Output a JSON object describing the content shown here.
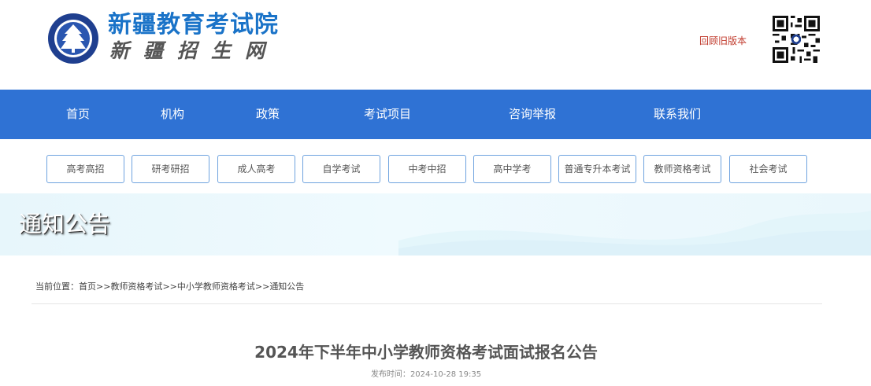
{
  "header": {
    "site_title": "新疆教育考试院",
    "site_subtitle": "新疆招生网",
    "old_version_link": "回顾旧版本",
    "emblem_text": "新疆教育考试院"
  },
  "nav": {
    "items": [
      {
        "label": "首页"
      },
      {
        "label": "机构"
      },
      {
        "label": "政策"
      },
      {
        "label": "考试项目"
      },
      {
        "label": "咨询举报"
      },
      {
        "label": "联系我们"
      }
    ]
  },
  "categories": [
    {
      "label": "高考高招"
    },
    {
      "label": "研考研招"
    },
    {
      "label": "成人高考"
    },
    {
      "label": "自学考试"
    },
    {
      "label": "中考中招"
    },
    {
      "label": "高中学考"
    },
    {
      "label": "普通专升本考试"
    },
    {
      "label": "教师资格考试"
    },
    {
      "label": "社会考试"
    }
  ],
  "banner": {
    "title": "通知公告"
  },
  "breadcrumb": {
    "prefix": "当前位置：",
    "items": [
      {
        "label": "首页"
      },
      {
        "label": "教师资格考试"
      },
      {
        "label": "中小学教师资格考试"
      },
      {
        "label": "通知公告"
      }
    ],
    "separator": ">>"
  },
  "article": {
    "title": "2024年下半年中小学教师资格考试面试报名公告",
    "publish_label": "发布时间：",
    "publish_time": "2024-10-28 19:35"
  },
  "colors": {
    "nav_bg": "#2f72d4",
    "brand_blue": "#1a73c8",
    "link_red": "#c0392b",
    "button_border": "#6fa3df"
  }
}
